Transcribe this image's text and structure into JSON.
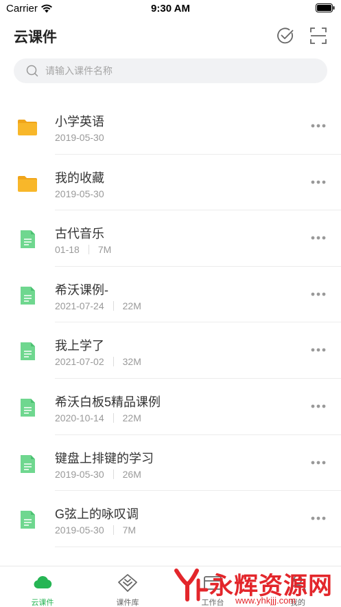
{
  "status_bar": {
    "carrier": "Carrier",
    "time": "9:30 AM"
  },
  "header": {
    "title": "云课件"
  },
  "search": {
    "placeholder": "请输入课件名称"
  },
  "colors": {
    "accent": "#26b554",
    "folder": "#f8b72a",
    "file": "#6fd78f",
    "watermark": "#e3262b"
  },
  "items": [
    {
      "type": "folder",
      "icon": "folder-icon",
      "title": "小学英语",
      "date": "2019-05-30",
      "size": ""
    },
    {
      "type": "folder",
      "icon": "folder-icon",
      "title": "我的收藏",
      "date": "2019-05-30",
      "size": ""
    },
    {
      "type": "file",
      "icon": "document-icon",
      "title": "古代音乐",
      "date": "01-18",
      "size": "7M"
    },
    {
      "type": "file",
      "icon": "document-icon",
      "title": "希沃课例-",
      "date": "2021-07-24",
      "size": "22M"
    },
    {
      "type": "file",
      "icon": "document-icon",
      "title": "我上学了",
      "date": "2021-07-02",
      "size": "32M"
    },
    {
      "type": "file",
      "icon": "document-icon",
      "title": "希沃白板5精品课例",
      "date": "2020-10-14",
      "size": "22M"
    },
    {
      "type": "file",
      "icon": "document-icon",
      "title": "键盘上排键的学习",
      "date": "2019-05-30",
      "size": "26M"
    },
    {
      "type": "file",
      "icon": "document-icon",
      "title": "G弦上的咏叹调",
      "date": "2019-05-30",
      "size": "7M"
    }
  ],
  "tabs": [
    {
      "label": "云课件",
      "icon": "cloud-icon",
      "active": true
    },
    {
      "label": "课件库",
      "icon": "library-icon",
      "active": false
    },
    {
      "label": "工作台",
      "icon": "workbench-icon",
      "active": false
    },
    {
      "label": "我的",
      "icon": "profile-icon",
      "active": false
    }
  ],
  "watermark": {
    "name": "永辉资源网",
    "url": "www.yhkjjj.com"
  }
}
